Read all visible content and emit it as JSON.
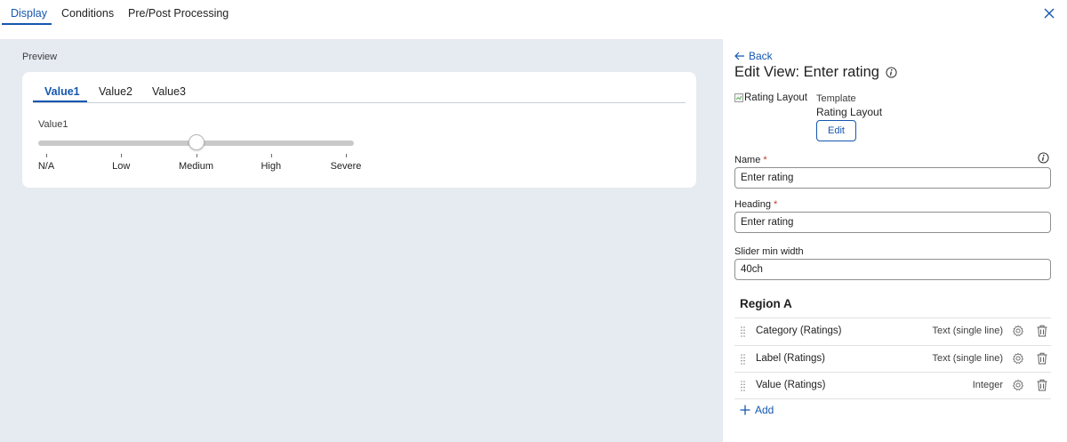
{
  "top_tabs": [
    {
      "label": "Display",
      "active": true
    },
    {
      "label": "Conditions",
      "active": false
    },
    {
      "label": "Pre/Post Processing",
      "active": false
    }
  ],
  "preview": {
    "label": "Preview",
    "tabs": [
      {
        "label": "Value1",
        "active": true
      },
      {
        "label": "Value2",
        "active": false
      },
      {
        "label": "Value3",
        "active": false
      }
    ],
    "slider": {
      "label": "Value1",
      "options": [
        "N/A",
        "Low",
        "Medium",
        "High",
        "Severe"
      ],
      "selected": "Medium"
    }
  },
  "panel": {
    "back_label": "Back",
    "title": "Edit View: Enter rating",
    "template_image_alt": "Rating Layout",
    "template_label": "Template",
    "template_value": "Rating Layout",
    "edit_label": "Edit",
    "name_label": "Name",
    "name_value": "Enter rating",
    "heading_label": "Heading",
    "heading_value": "Enter rating",
    "slider_min_width_label": "Slider min width",
    "slider_min_width_value": "40ch",
    "region_title": "Region A",
    "region_fields": [
      {
        "name": "Category (Ratings)",
        "type": "Text (single line)"
      },
      {
        "name": "Label (Ratings)",
        "type": "Text (single line)"
      },
      {
        "name": "Value (Ratings)",
        "type": "Integer"
      }
    ],
    "add_label": "Add"
  },
  "colors": {
    "accent": "#1557b0",
    "preview_background": "#e6eaf1",
    "required": "#c0392b"
  }
}
